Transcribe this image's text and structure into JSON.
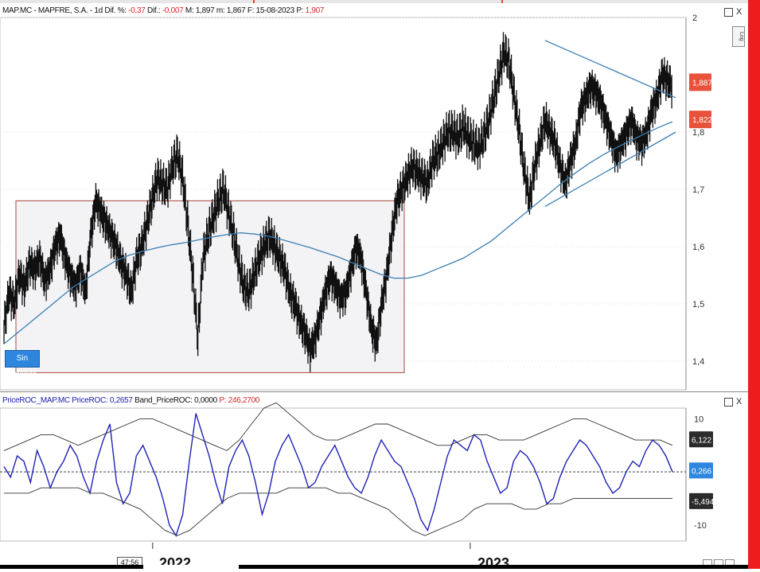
{
  "header": {
    "symbol": "MAP.MC - MAPFRE, S.A. - 1d",
    "dif_pct_label": "Dif. %:",
    "dif_pct": "-0,37",
    "dif_label": "Dif.:",
    "dif": "-0,007",
    "max_label": "M:",
    "max": "1,897",
    "min_label": "m:",
    "min": "1,867",
    "date_label": "F:",
    "date": "15-08-2023",
    "price_label": "P:",
    "price": "1,907"
  },
  "indicator_header": {
    "name": "PriceROC_MAP.MC",
    "roc_label": "PriceROC:",
    "roc": "0,2657",
    "band_label": "Band_PriceROC:",
    "band": "0,0000",
    "p_label": "P:",
    "p": "246,2700"
  },
  "controls": {
    "close": "X",
    "log": "Log"
  },
  "badges": {
    "sin_ordenes": "Sin órdenes"
  },
  "colors": {
    "candle": "#111111",
    "ma": "#3c7fb1",
    "trend": "#3c7fb1",
    "box_border": "#a84a3a",
    "box_fill": "#f3f3f6",
    "roc": "#1f22b5",
    "band": "#333333",
    "badge_red": "#e8523b",
    "badge_black": "#2b2b2b",
    "badge_blue": "#2e86de"
  },
  "time_badge": "47:56",
  "chart_data": [
    {
      "type": "line",
      "series_style": "ohlc-bars",
      "ylim": [
        1.35,
        2.0
      ],
      "yticks": [
        "2",
        "1,8",
        "1,7",
        "1,6",
        "1,5",
        "1,4"
      ],
      "ytick_values": [
        2.0,
        1.8,
        1.7,
        1.6,
        1.5,
        1.4
      ],
      "price_labels": [
        {
          "text": "1,887",
          "value": 1.887,
          "color": "#e8523b"
        },
        {
          "text": "1,822",
          "value": 1.822,
          "color": "#e8523b"
        }
      ],
      "price_series": [
        1.46,
        1.52,
        1.5,
        1.55,
        1.53,
        1.57,
        1.56,
        1.58,
        1.54,
        1.56,
        1.6,
        1.62,
        1.58,
        1.55,
        1.53,
        1.56,
        1.52,
        1.62,
        1.68,
        1.66,
        1.64,
        1.62,
        1.6,
        1.57,
        1.55,
        1.52,
        1.58,
        1.6,
        1.64,
        1.68,
        1.72,
        1.71,
        1.7,
        1.74,
        1.76,
        1.72,
        1.64,
        1.55,
        1.44,
        1.58,
        1.62,
        1.65,
        1.68,
        1.7,
        1.66,
        1.62,
        1.57,
        1.53,
        1.52,
        1.55,
        1.58,
        1.6,
        1.62,
        1.6,
        1.58,
        1.56,
        1.52,
        1.5,
        1.47,
        1.45,
        1.42,
        1.44,
        1.48,
        1.52,
        1.55,
        1.53,
        1.51,
        1.52,
        1.56,
        1.6,
        1.58,
        1.52,
        1.46,
        1.43,
        1.5,
        1.55,
        1.62,
        1.68,
        1.7,
        1.72,
        1.74,
        1.73,
        1.72,
        1.71,
        1.75,
        1.76,
        1.78,
        1.8,
        1.8,
        1.79,
        1.81,
        1.79,
        1.78,
        1.77,
        1.79,
        1.82,
        1.86,
        1.9,
        1.94,
        1.92,
        1.86,
        1.8,
        1.73,
        1.68,
        1.74,
        1.78,
        1.82,
        1.8,
        1.78,
        1.74,
        1.71,
        1.75,
        1.78,
        1.84,
        1.86,
        1.88,
        1.87,
        1.85,
        1.82,
        1.79,
        1.76,
        1.78,
        1.8,
        1.82,
        1.79,
        1.78,
        1.8,
        1.84,
        1.86,
        1.9,
        1.89,
        1.88
      ],
      "ma_series": [
        1.43,
        1.45,
        1.47,
        1.49,
        1.51,
        1.53,
        1.545,
        1.56,
        1.575,
        1.585,
        1.592,
        1.598,
        1.603,
        1.607,
        1.612,
        1.617,
        1.621,
        1.624,
        1.622,
        1.618,
        1.612,
        1.605,
        1.598,
        1.59,
        1.582,
        1.572,
        1.562,
        1.552,
        1.545,
        1.545,
        1.55,
        1.56,
        1.57,
        1.58,
        1.595,
        1.61,
        1.63,
        1.65,
        1.67,
        1.69,
        1.71,
        1.728,
        1.745,
        1.76,
        1.773,
        1.785,
        1.797,
        1.808,
        1.818
      ],
      "range_box": {
        "y_top": 1.68,
        "y_bottom": 1.38
      },
      "trendlines": [
        {
          "from": [
            0.794,
            1.96
          ],
          "to": [
            0.985,
            1.86
          ]
        },
        {
          "from": [
            0.794,
            1.67
          ],
          "to": [
            0.985,
            1.8
          ]
        }
      ],
      "xticks": [
        "2022",
        "2023"
      ],
      "xtick_positions": [
        0.23,
        0.694
      ]
    },
    {
      "type": "line",
      "ylim": [
        -13,
        12
      ],
      "yticks": [
        "10",
        "-10"
      ],
      "ytick_values": [
        10,
        -10
      ],
      "zero_line": 0,
      "value_labels": [
        {
          "text": "6,122",
          "value": 6.122,
          "color": "#2b2b2b"
        },
        {
          "text": "0,266",
          "value": 0.266,
          "color": "#2e86de"
        },
        {
          "text": "-5,494",
          "value": -5.494,
          "color": "#2b2b2b"
        }
      ],
      "series": [
        {
          "name": "PriceROC",
          "values": [
            1,
            -1,
            3,
            2,
            -2,
            4,
            1,
            -3,
            0,
            2,
            5,
            3,
            -1,
            -4,
            2,
            6,
            9,
            -2,
            -6,
            -4,
            3,
            5,
            2,
            -1,
            -5,
            -10,
            -12,
            -8,
            2,
            11,
            7,
            3,
            -2,
            -6,
            1,
            4,
            6,
            3,
            -2,
            -8,
            -4,
            2,
            5,
            7,
            4,
            1,
            -3,
            -2,
            1,
            3,
            5,
            2,
            -1,
            -3,
            -4,
            -1,
            3,
            6,
            4,
            2,
            1,
            -2,
            -5,
            -9,
            -11,
            -7,
            -2,
            3,
            6,
            5,
            4,
            7,
            6,
            2,
            -1,
            -4,
            -3,
            2,
            4,
            3,
            1,
            -2,
            -6,
            -5,
            -1,
            2,
            4,
            6,
            5,
            3,
            1,
            -2,
            -4,
            -3,
            0,
            2,
            1,
            4,
            6,
            5,
            3,
            0
          ]
        },
        {
          "name": "Band upper",
          "values": [
            4,
            5,
            6,
            7,
            7,
            6,
            5,
            6,
            7,
            8,
            9,
            10,
            10,
            9,
            8,
            7,
            6,
            5,
            4,
            6,
            9,
            12,
            13,
            11,
            9,
            7,
            6,
            6,
            7,
            8,
            9,
            9,
            8,
            7,
            6,
            5,
            5,
            6,
            7,
            7,
            6,
            6,
            6,
            7,
            8,
            9,
            10,
            10,
            9,
            8,
            7,
            6,
            6,
            6,
            5
          ]
        },
        {
          "name": "Band lower",
          "values": [
            -4,
            -4,
            -4,
            -3,
            -3,
            -3,
            -3,
            -4,
            -4,
            -5,
            -6,
            -7,
            -9,
            -11,
            -12,
            -11,
            -9,
            -7,
            -5,
            -4,
            -4,
            -4,
            -4,
            -3,
            -3,
            -3,
            -3,
            -4,
            -4,
            -5,
            -6,
            -7,
            -9,
            -11,
            -12,
            -11,
            -10,
            -9,
            -7,
            -6,
            -6,
            -6,
            -7,
            -7,
            -6,
            -6,
            -5,
            -5,
            -5,
            -5,
            -5,
            -5,
            -5,
            -5,
            -5
          ]
        }
      ]
    }
  ]
}
